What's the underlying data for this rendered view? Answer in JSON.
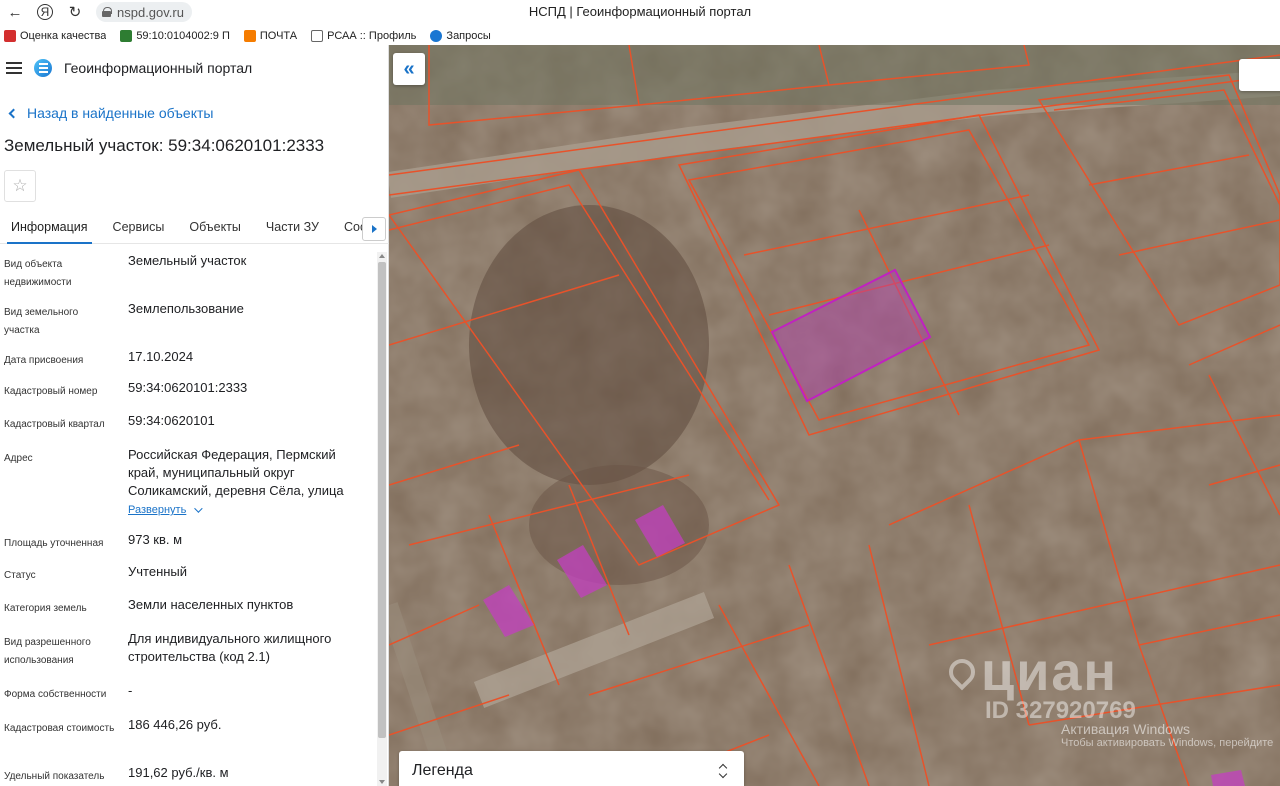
{
  "browser": {
    "back": "←",
    "ya": "Я",
    "reload": "↻",
    "url": "nspd.gov.ru",
    "title": "НСПД | Геоинформационный портал"
  },
  "bookmarks": [
    {
      "label": "Оценка качества",
      "icon": "red-flag-icon",
      "color": "#d32f2f"
    },
    {
      "label": "59:10:0104002:9 П",
      "icon": "green-n-icon",
      "color": "#2e7d32"
    },
    {
      "label": "ПОЧТА",
      "icon": "orange-play-icon",
      "color": "#f57c00"
    },
    {
      "label": "РСАА :: Профиль",
      "icon": "page-icon",
      "color": "#666666"
    },
    {
      "label": "Запросы",
      "icon": "person-icon",
      "color": "#1976d2"
    }
  ],
  "app": {
    "title": "Геоинформационный портал"
  },
  "back_link": "Назад в найденные объекты",
  "object_title": "Земельный участок: 59:34:0620101:2333",
  "star": "☆",
  "tabs": [
    {
      "label": "Информация",
      "active": true
    },
    {
      "label": "Сервисы"
    },
    {
      "label": "Объекты"
    },
    {
      "label": "Части ЗУ"
    },
    {
      "label": "Состав"
    }
  ],
  "properties": [
    {
      "label": "Вид объекта недвижимости",
      "value": "Земельный участок"
    },
    {
      "label": "Вид земельного участка",
      "value": "Землепользование"
    },
    {
      "label": "Дата присвоения",
      "value": "17.10.2024"
    },
    {
      "label": "Кадастровый номер",
      "value": "59:34:0620101:2333"
    },
    {
      "label": "Кадастровый квартал",
      "value": "59:34:0620101"
    },
    {
      "label": "Адрес",
      "value": "Российская Федерация, Пермский край, муниципальный округ Соликамский, деревня Сёла, улица",
      "expand": "Развернуть"
    },
    {
      "label": "Площадь уточненная",
      "value": "973 кв. м"
    },
    {
      "label": "Статус",
      "value": "Учтенный"
    },
    {
      "label": "Категория земель",
      "value": "Земли населенных пунктов"
    },
    {
      "label": "Вид разрешенного использования",
      "value": "Для индивидуального жилищного строительства (код 2.1)"
    },
    {
      "label": "Форма собственности",
      "value": "-"
    },
    {
      "label": "Кадастровая стоимость",
      "value": "186 446,26 руб."
    },
    {
      "label": "Удельный показатель",
      "value": "191,62 руб./кв. м"
    }
  ],
  "map": {
    "collapse": "«",
    "legend": "Легенда",
    "watermark_logo": "циан",
    "watermark_id": "ID 327920769",
    "windows_activation_1": "Активация Windows",
    "windows_activation_2": "Чтобы активировать Windows, перейдите",
    "colors": {
      "parcel_line": "#e8522a",
      "selected_fill": "#b33fb0"
    }
  }
}
